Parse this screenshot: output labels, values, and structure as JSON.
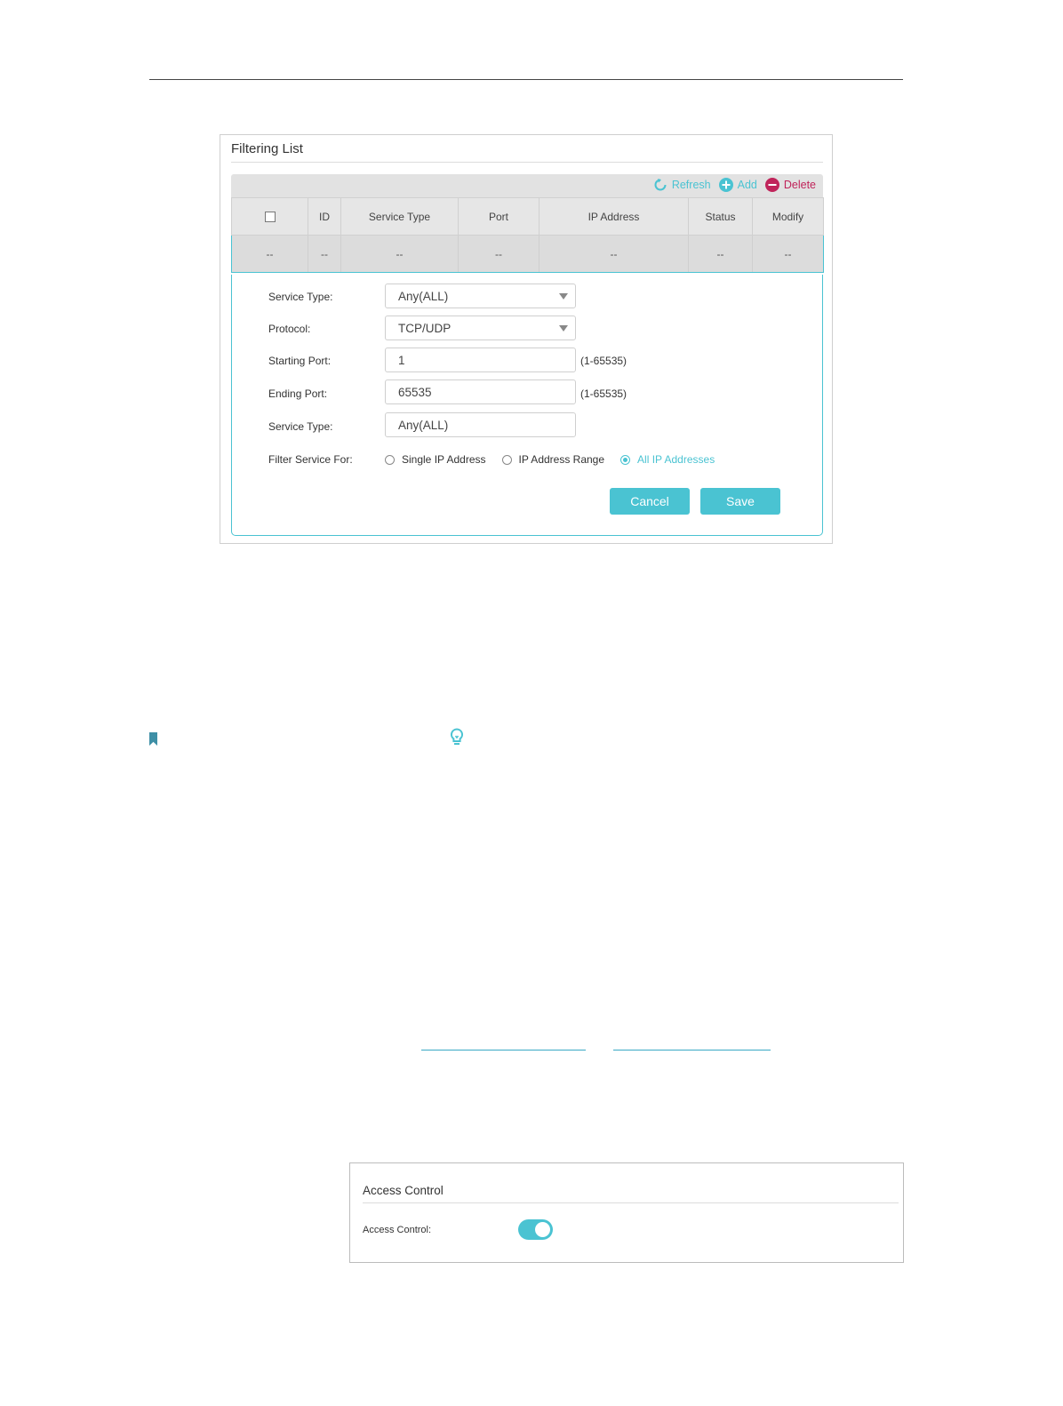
{
  "filtering_list": {
    "title": "Filtering List",
    "toolbar": {
      "refresh": "Refresh",
      "add": "Add",
      "delete": "Delete"
    },
    "columns": [
      "",
      "ID",
      "Service Type",
      "Port",
      "IP Address",
      "Status",
      "Modify"
    ],
    "row": [
      "--",
      "--",
      "--",
      "--",
      "--",
      "--",
      "--"
    ],
    "form": {
      "service_type_label": "Service Type:",
      "service_type_value": "Any(ALL)",
      "protocol_label": "Protocol:",
      "protocol_value": "TCP/UDP",
      "starting_port_label": "Starting Port:",
      "starting_port_value": "1",
      "starting_port_hint": "(1-65535)",
      "ending_port_label": "Ending Port:",
      "ending_port_value": "65535",
      "ending_port_hint": "(1-65535)",
      "service_type2_label": "Service Type:",
      "service_type2_value": "Any(ALL)",
      "filter_for_label": "Filter Service For:",
      "filter_options": [
        "Single IP Address",
        "IP Address Range",
        "All IP Addresses"
      ],
      "filter_selected": "All IP Addresses",
      "cancel": "Cancel",
      "save": "Save"
    }
  },
  "access_control": {
    "title": "Access Control",
    "label": "Access Control:",
    "enabled": true
  },
  "colors": {
    "accent": "#4ac3d2",
    "delete": "#c0245a"
  },
  "icons": [
    "refresh-icon",
    "add-icon",
    "delete-icon",
    "dropdown-caret-icon",
    "bookmark-icon",
    "lightbulb-icon"
  ]
}
